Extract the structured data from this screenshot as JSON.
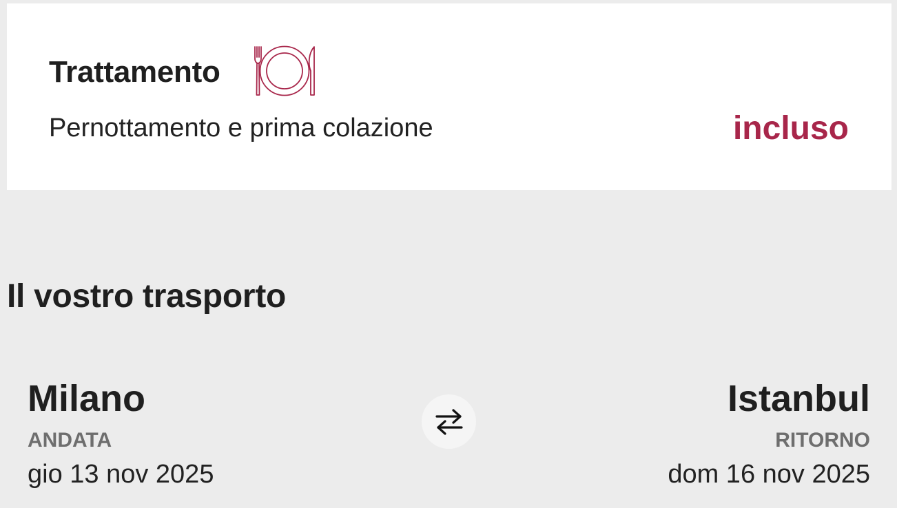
{
  "treatment": {
    "title": "Trattamento",
    "icon": "fork-plate-knife-icon",
    "value": "Pernottamento e prima colazione",
    "status": "incluso",
    "accent_color": "#a8264a"
  },
  "transport": {
    "title": "Il vostro trasporto",
    "swap_icon": "swap-arrows-icon",
    "outbound": {
      "city": "Milano",
      "label": "ANDATA",
      "date": "gio 13 nov 2025"
    },
    "return": {
      "city": "Istanbul",
      "label": "RITORNO",
      "date": "dom 16 nov 2025"
    }
  }
}
